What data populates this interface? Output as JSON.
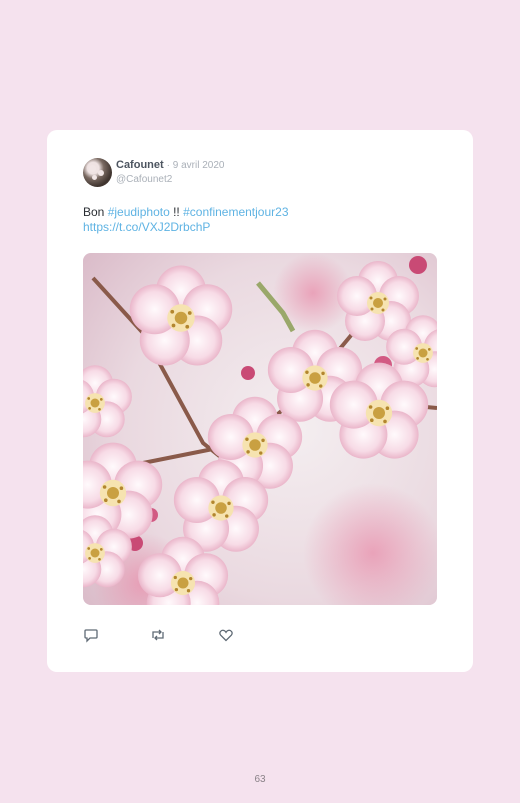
{
  "tweet": {
    "author_name": "Cafounet",
    "date": "· 9 avril 2020",
    "handle": "@Cafounet2",
    "text_prefix": "Bon ",
    "hashtag1": "#jeudiphoto",
    "text_middle": " !! ",
    "hashtag2": "#confinementjour23",
    "link": "https://t.co/VXJ2DrbchP",
    "photo_subject": "cherry blossoms"
  },
  "actions": {
    "reply_icon": "reply-icon",
    "retweet_icon": "retweet-icon",
    "like_icon": "heart-icon"
  },
  "page": {
    "number": "63"
  },
  "colors": {
    "background": "#f5e2ee",
    "card": "#ffffff",
    "link": "#5fb3e3",
    "muted": "#aab0b8"
  }
}
